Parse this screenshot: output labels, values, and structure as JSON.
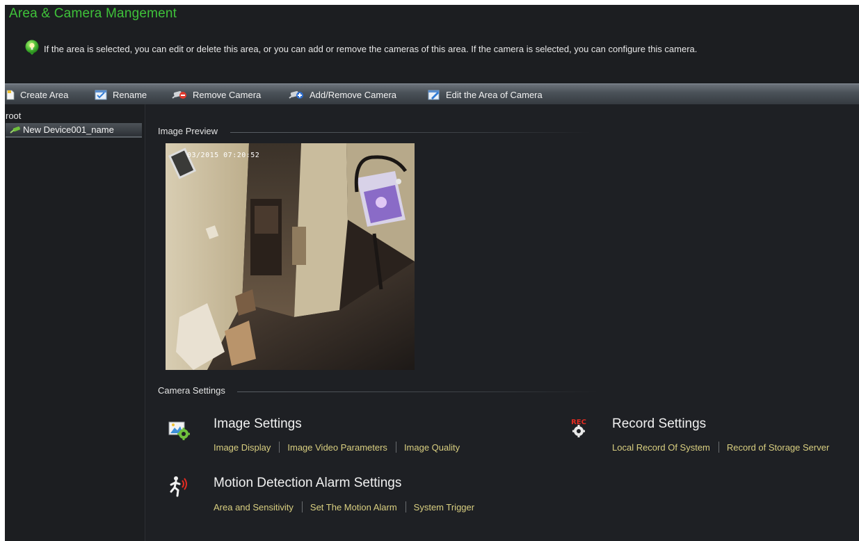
{
  "header": {
    "title": "Area & Camera Mangement",
    "tip": "If the area is selected, you can edit or delete this area, or you can add or remove the cameras of this area. If the camera is selected, you can configure this camera.",
    "tip_icon": "lightbulb-icon"
  },
  "toolbar": {
    "items": [
      {
        "label": "Create Area",
        "icon": "document-icon"
      },
      {
        "label": "Rename",
        "icon": "rename-icon"
      },
      {
        "label": "Remove Camera",
        "icon": "camera-remove-icon"
      },
      {
        "label": "Add/Remove Camera",
        "icon": "camera-add-icon"
      },
      {
        "label": "Edit the Area of Camera",
        "icon": "edit-icon"
      }
    ]
  },
  "tree": {
    "root": "root",
    "items": [
      {
        "label": "New Device001_name",
        "icon": "camera-icon",
        "selected": true
      }
    ]
  },
  "preview": {
    "label": "Image Preview",
    "timestamp": "03/2015 07:20:52"
  },
  "camera_settings": {
    "label": "Camera Settings",
    "groups": [
      {
        "title": "Image Settings",
        "icon": "image-settings-icon",
        "links": [
          "Image Display",
          "Image Video Parameters",
          "Image Quality"
        ]
      },
      {
        "title": "Record Settings",
        "icon": "record-settings-icon",
        "icon_text": "REC",
        "links": [
          "Local Record Of System",
          "Record of Storage Server"
        ]
      },
      {
        "title": "Motion Detection Alarm Settings",
        "icon": "motion-alarm-icon",
        "links": [
          "Area and Sensitivity",
          "Set The Motion Alarm",
          "System Trigger"
        ]
      }
    ]
  },
  "colors": {
    "title_green": "#3fc23a",
    "link_yellow": "#d9cf80",
    "background": "#1c1e21"
  }
}
